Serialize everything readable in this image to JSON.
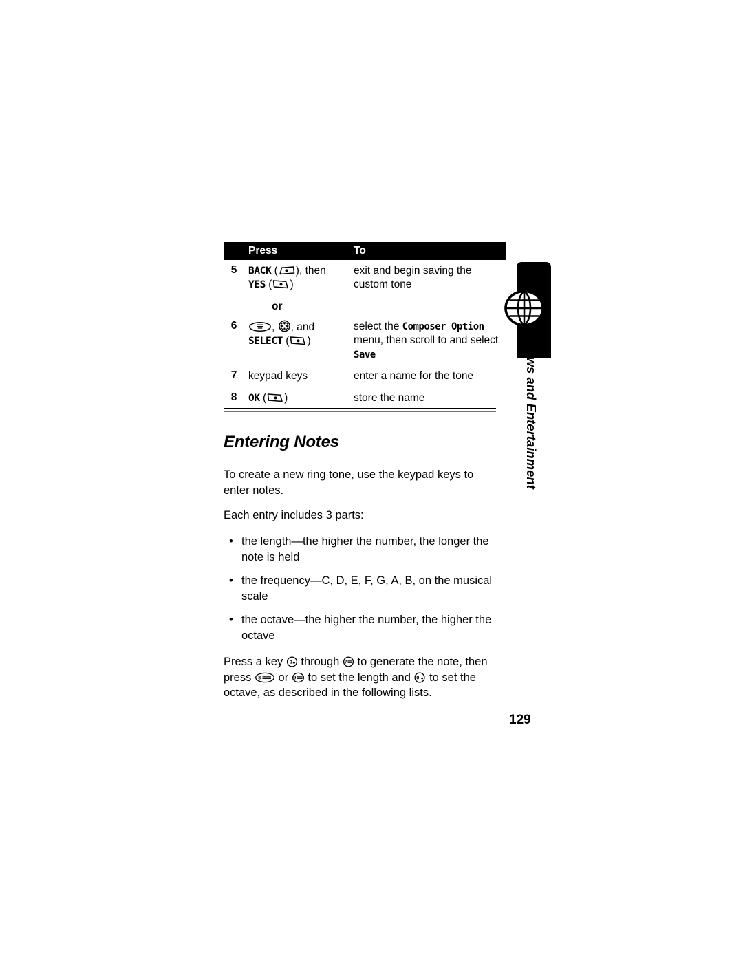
{
  "table": {
    "headers": {
      "num": "",
      "press": "Press",
      "to": "To"
    },
    "rows": [
      {
        "num": "5",
        "press_pre": "BACK",
        "press_mid": ", then",
        "press_pre2": "YES",
        "press_post2": "",
        "to": "exit and begin saving the custom tone"
      },
      {
        "separator_label": "or"
      },
      {
        "num": "6",
        "press_menu": ", ",
        "press_and": ", and",
        "press_select": "SELECT",
        "to_prefix": "select the ",
        "to_mono1": "Composer Option",
        "to_middle": " menu, then scroll to and select ",
        "to_mono2": "Save"
      },
      {
        "num": "7",
        "press_plain": "keypad keys",
        "to": "enter a name for the tone"
      },
      {
        "num": "8",
        "press_pre": "OK",
        "to": "store the name"
      }
    ]
  },
  "section": {
    "heading": "Entering Notes",
    "intro": "To create a new ring tone, use the keypad keys to enter notes.",
    "parts_lead": "Each entry includes 3 parts:",
    "bullets": [
      "the length—the higher the number, the longer the note is held",
      "the frequency—C, D, E, F, G, A, B, on the musical scale",
      "the octave—the higher the number, the higher the octave"
    ],
    "closing": {
      "p1": "Press a key ",
      "p2": " through ",
      "p3": " to generate the note, then press ",
      "p4": " or ",
      "p5": " to set the length and ",
      "p6": " to set the octave, as described in the following lists."
    }
  },
  "side_tab": {
    "label": "News and Entertainment",
    "icon": "globe-icon",
    "color": "#000000"
  },
  "footer": {
    "page_number": "129"
  },
  "icons": {
    "softkey_left": "softkey-left-icon",
    "softkey_right": "softkey-right-icon",
    "menu_key": "menu-key-icon",
    "nav_disc": "nav-disc-icon",
    "key_1": "keypad-key-1-icon",
    "key_7": "keypad-key-7-icon",
    "key_8": "keypad-key-8-icon",
    "key_9": "keypad-key-9-icon",
    "key_0": "keypad-key-0-icon",
    "bullet": "•"
  }
}
